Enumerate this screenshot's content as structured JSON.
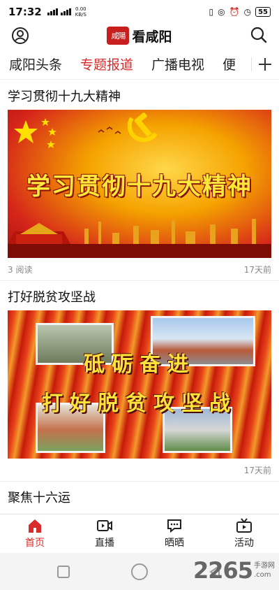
{
  "status_bar": {
    "time": "17:32",
    "network_speed_value": "0.00",
    "network_speed_unit": "KB/S",
    "battery": "55"
  },
  "header": {
    "logo_seal_text": "咸陽",
    "logo_text": "看咸阳",
    "user_icon": "user-circle-icon",
    "search_icon": "search-icon"
  },
  "tabs": [
    {
      "label": "咸阳头条",
      "active": false
    },
    {
      "label": "专题报道",
      "active": true
    },
    {
      "label": "广播电视",
      "active": false
    },
    {
      "label": "便",
      "active": false
    }
  ],
  "tabs_add_icon": "plus-icon",
  "articles": [
    {
      "title": "学习贯彻十九大精神",
      "banner_text": "学习贯彻十九大精神",
      "reads": "3 阅读",
      "time": "17天前"
    },
    {
      "title": "打好脱贫攻坚战",
      "banner_line1": "砥砺奋进",
      "banner_line2": "打好脱贫攻坚战",
      "reads": "",
      "time": "17天前"
    },
    {
      "title": "聚焦十六运"
    }
  ],
  "bottom_nav": [
    {
      "label": "首页",
      "icon": "home-icon",
      "active": true
    },
    {
      "label": "直播",
      "icon": "video-icon",
      "active": false
    },
    {
      "label": "晒晒",
      "icon": "chat-bubble-icon",
      "active": false
    },
    {
      "label": "活动",
      "icon": "tv-icon",
      "active": false
    }
  ],
  "watermark": {
    "number": "2265",
    "top": "手游网",
    "bottom": ".com"
  },
  "colors": {
    "accent": "#d92b2b",
    "text": "#222222",
    "meta": "#888888"
  }
}
